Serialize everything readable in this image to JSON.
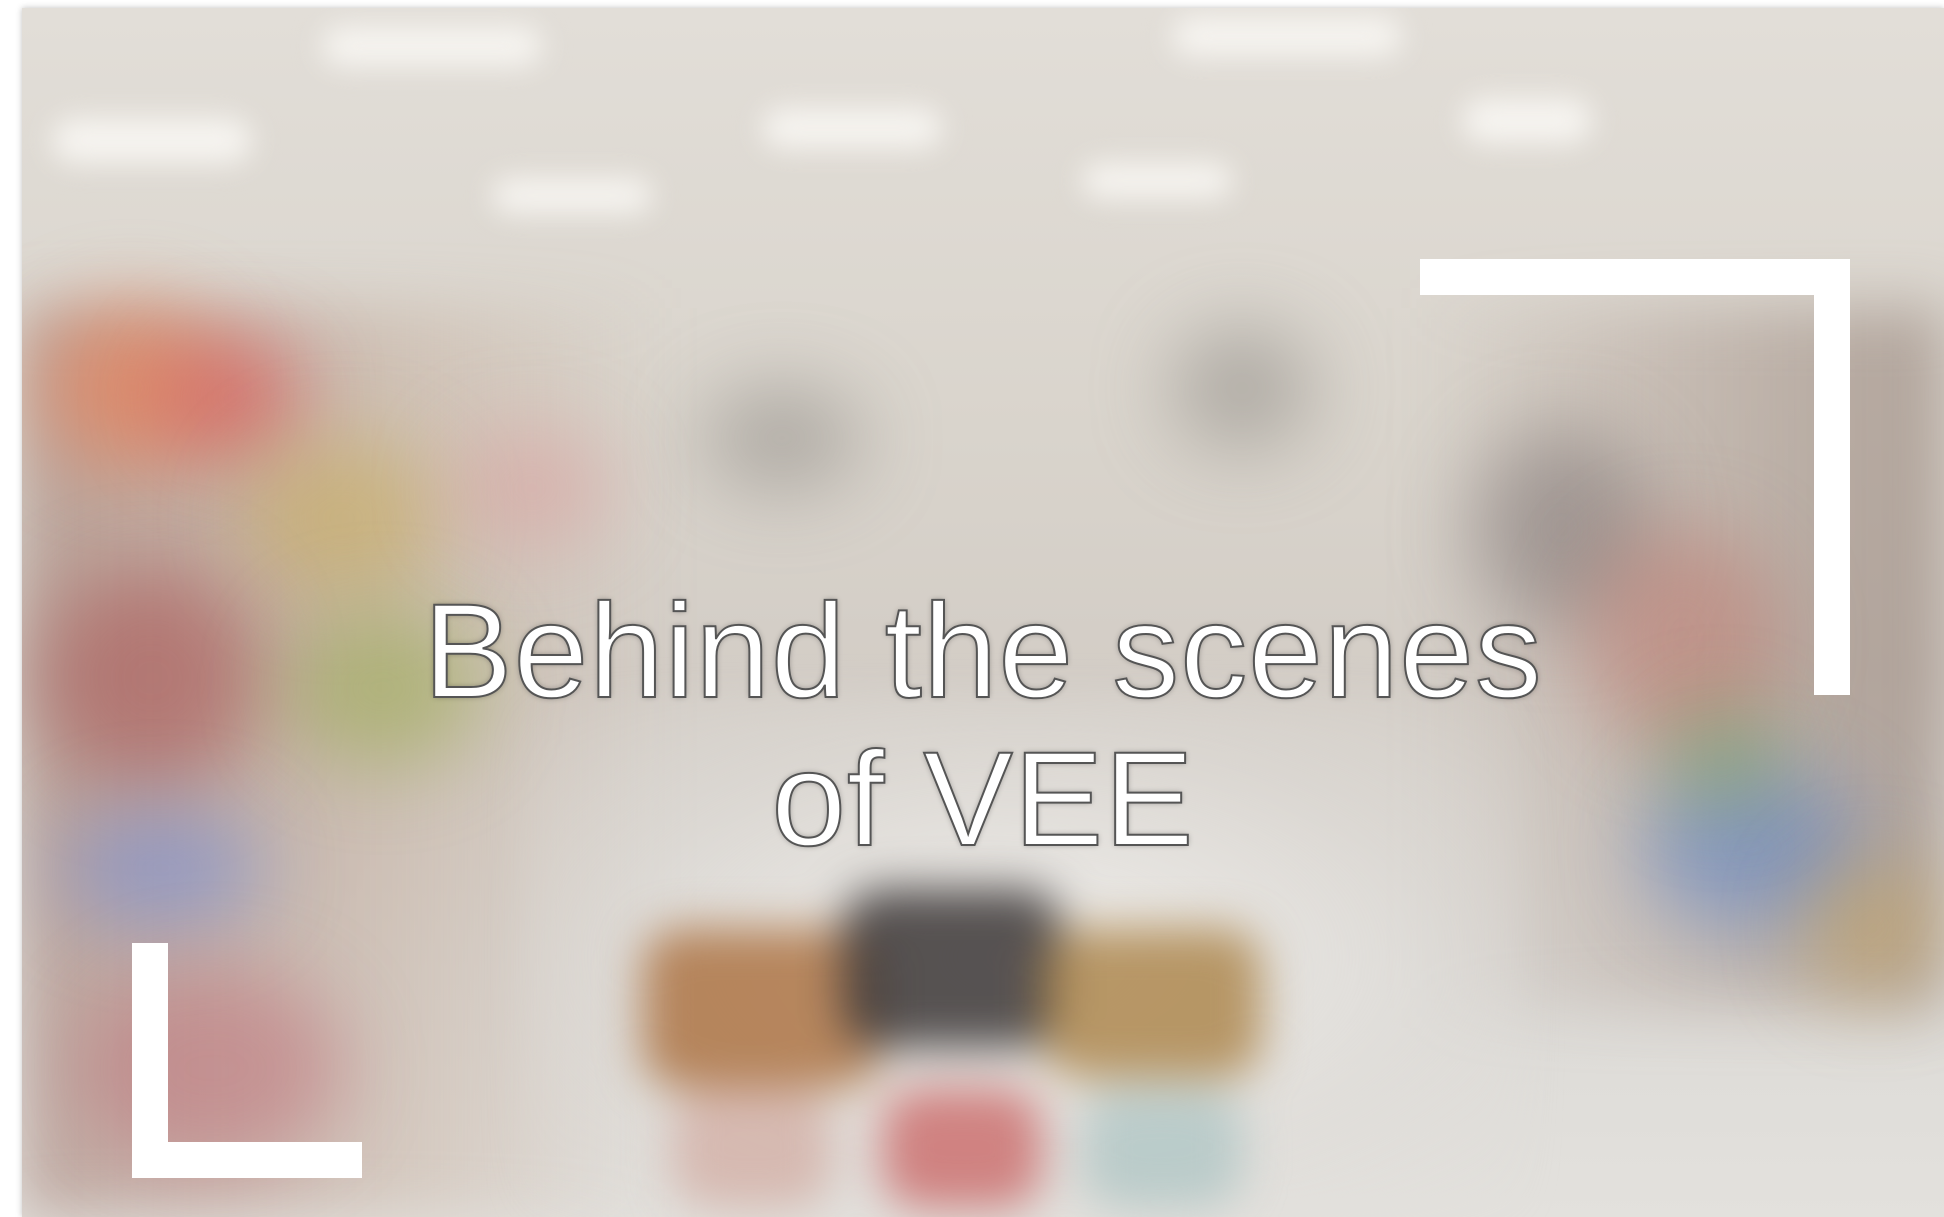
{
  "title": {
    "line1": "Behind the scenes",
    "line2": "of VEE"
  },
  "background": {
    "description_icon": "blurred-store-aisle-image"
  },
  "colors": {
    "bracket": "#ffffff",
    "title_text": "#ffffff",
    "title_outline": "#555555"
  }
}
